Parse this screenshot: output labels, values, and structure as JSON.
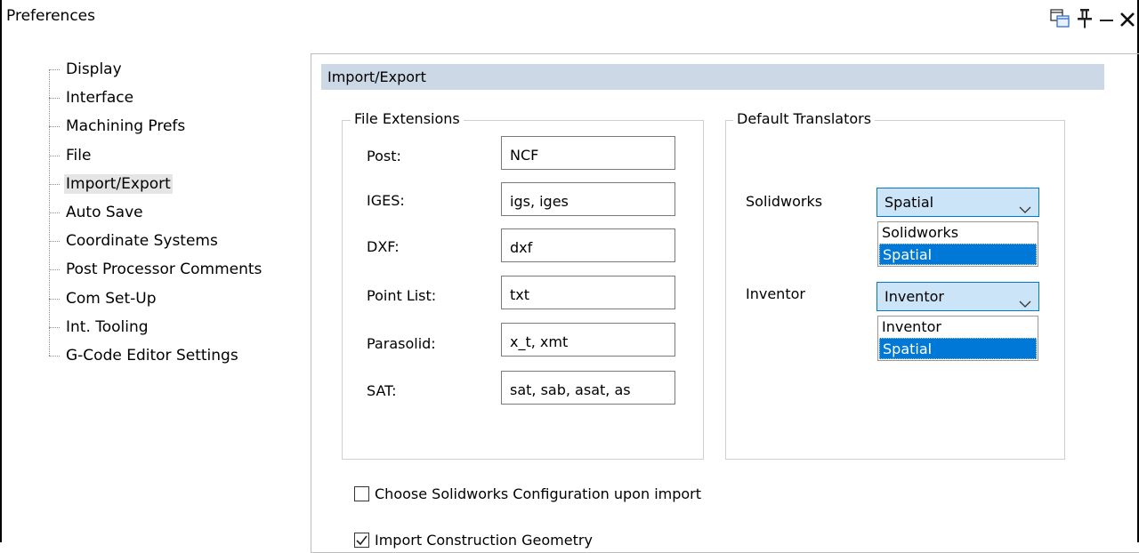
{
  "window": {
    "title": "Preferences",
    "icons": [
      "restore-window-icon",
      "pin-icon",
      "minimize-icon",
      "close-icon"
    ]
  },
  "sidebar": {
    "items": [
      {
        "label": "Display"
      },
      {
        "label": "Interface"
      },
      {
        "label": "Machining Prefs"
      },
      {
        "label": "File"
      },
      {
        "label": "Import/Export",
        "selected": true
      },
      {
        "label": "Auto Save"
      },
      {
        "label": "Coordinate Systems"
      },
      {
        "label": "Post Processor Comments"
      },
      {
        "label": "Com Set-Up"
      },
      {
        "label": "Int. Tooling"
      },
      {
        "label": "G-Code Editor Settings"
      }
    ]
  },
  "section": {
    "title": "Import/Export"
  },
  "file_extensions": {
    "title": "File Extensions",
    "fields": [
      {
        "label": "Post:",
        "value": "NCF"
      },
      {
        "label": "IGES:",
        "value": "igs, iges"
      },
      {
        "label": "DXF:",
        "value": "dxf"
      },
      {
        "label": "Point List:",
        "value": "txt"
      },
      {
        "label": "Parasolid:",
        "value": "x_t, xmt"
      },
      {
        "label": "SAT:",
        "value": "sat, sab, asat, as"
      }
    ]
  },
  "default_translators": {
    "title": "Default Translators",
    "solidworks": {
      "label": "Solidworks",
      "selected": "Spatial",
      "options": [
        "Solidworks",
        "Spatial"
      ]
    },
    "inventor": {
      "label": "Inventor",
      "selected": "Inventor",
      "options": [
        "Inventor",
        "Spatial"
      ]
    }
  },
  "options": {
    "choose_config": {
      "label": "Choose Solidworks Configuration upon import",
      "checked": false
    },
    "import_construction": {
      "label": "Import Construction Geometry",
      "checked": true
    }
  },
  "colors": {
    "section_bar": "#ccd8e6",
    "combo_focus_bg": "#cce4f7",
    "accent_blue": "#0078d7",
    "selected_tree_bg": "#e5e5e5"
  }
}
